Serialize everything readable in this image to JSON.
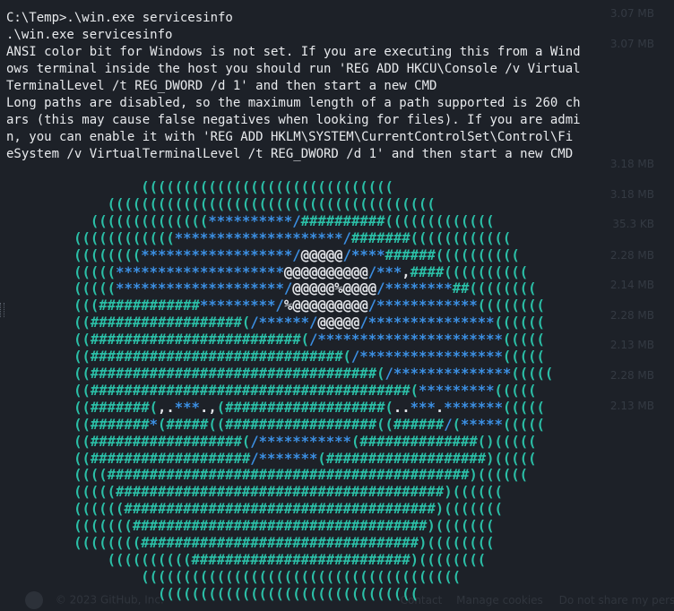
{
  "terminal": {
    "lines": [
      "C:\\Temp>.\\win.exe servicesinfo",
      ".\\win.exe servicesinfo",
      "ANSI color bit for Windows is not set. If you are executing this from a Wind",
      "ows terminal inside the host you should run 'REG ADD HKCU\\Console /v Virtual",
      "TerminalLevel /t REG_DWORD /d 1' and then start a new CMD",
      "Long paths are disabled, so the maximum length of a path supported is 260 ch",
      "ars (this may cause false negatives when looking for files). If you are admi",
      "n, you can enable it with 'REG ADD HKLM\\SYSTEM\\CurrentControlSet\\Control\\Fi",
      "eSystem /v VirtualTerminalLevel /t REG_DWORD /d 1' and then start a new CMD"
    ],
    "banner": [
      "                ((((((((((((((((((((((((((((((",
      "            (((((((((((((((((((((((((((((((((((((((",
      "          ((((((((((((((**********/##########(((((((((((((",
      "        ((((((((((((********************/#######((((((((((((",
      "        ((((((((******************/@@@@@/****######((((((((((",
      "        (((((********************@@@@@@@@@@/***,####((((((((((",
      "        (((((********************/@@@@@%@@@@/********##((((((((",
      "        (((############*********/%@@@@@@@@@/************((((((((",
      "        ((##################(/******/@@@@@/***************((((((",
      "        ((#########################(/**********************(((((",
      "        ((##############################(/*****************(((((",
      "        ((##################################(/**************(((((",
      "        ((######################################(*********(((((",
      "        ((#######(,.***.,(###################(..***.*******(((((",
      "        ((#######*(#####((##################((######/(*****(((((",
      "        ((##################(/***********(##############()(((((",
      "        ((###################/*******(###################)(((((",
      "        ((((###########################################)((((((",
      "        (((((#######################################)((((((",
      "        ((((((#####################################)(((((((",
      "        (((((((###################################)(((((((",
      "        ((((((((#################################)((((((((",
      "            ((((((((((##########################)((((((((",
      "                ((((((((((((((((((((((((((((((((((((((",
      "                  ((((((((((((((((((((((((((((((("
    ]
  },
  "background_window": {
    "file_sizes": [
      "3.07 MB",
      "3.07 MB",
      "3.18 MB",
      "3.18 MB",
      "35.3 KB",
      "2.28 MB",
      "2.14 MB",
      "2.28 MB",
      "2.13 MB",
      "2.28 MB",
      "2.13 MB"
    ],
    "footer": {
      "copyright": "© 2023 GitHub, Inc.",
      "links": [
        "Contact",
        "Manage cookies",
        "Do not share my personal info"
      ]
    }
  },
  "colors": {
    "background": "#1d2128",
    "text": "#e8eaed",
    "banner_teal": "#2bbfa7",
    "banner_blue": "#3b8fe3",
    "banner_white": "#e4e6ea"
  }
}
